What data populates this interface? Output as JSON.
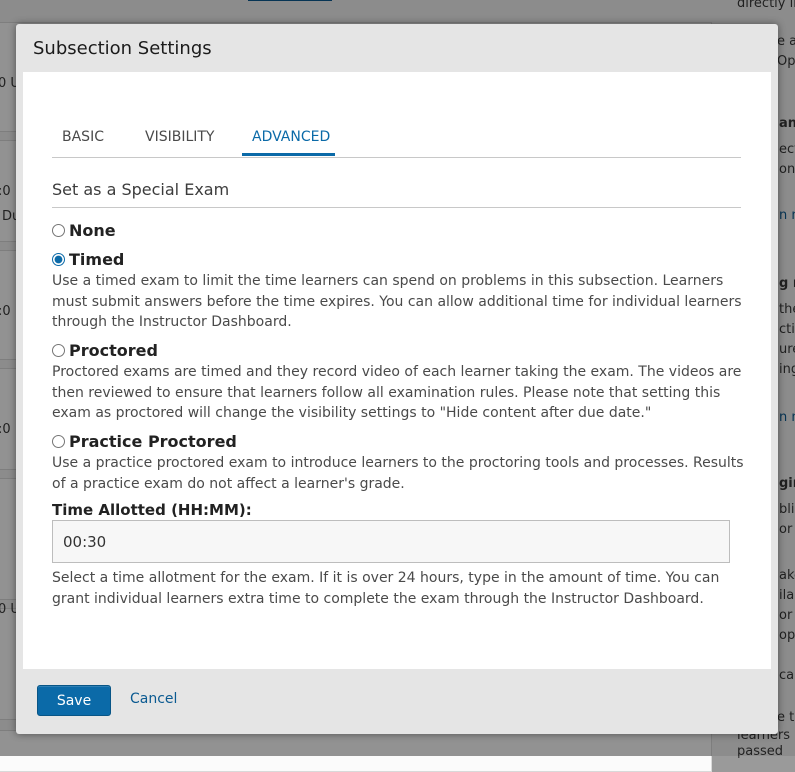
{
  "background": {
    "fragments": [
      "directly in",
      "e a",
      "Op",
      "ani",
      "ect",
      "ons",
      "n m",
      "g r",
      "the",
      "ctio",
      "ure",
      "ing p",
      "n m",
      "ging",
      "blis",
      "or a",
      "ake",
      "ilab",
      "or t",
      "opt",
      "calc",
      "e t",
      "learners",
      "passed",
      "0 U",
      ":0",
      "Du",
      ":0",
      ":0",
      "0 U"
    ]
  },
  "modal": {
    "title": "Subsection Settings",
    "tabs": [
      {
        "label": "BASIC",
        "active": false
      },
      {
        "label": "VISIBILITY",
        "active": false
      },
      {
        "label": "ADVANCED",
        "active": true
      }
    ],
    "section_heading": "Set as a Special Exam",
    "options": [
      {
        "label": "None",
        "selected": false,
        "description": ""
      },
      {
        "label": "Timed",
        "selected": true,
        "description": "Use a timed exam to limit the time learners can spend on problems in this subsection. Learners must submit answers before the time expires. You can allow additional time for individual learners through the Instructor Dashboard."
      },
      {
        "label": "Proctored",
        "selected": false,
        "description": "Proctored exams are timed and they record video of each learner taking the exam. The videos are then reviewed to ensure that learners follow all examination rules. Please note that setting this exam as proctored will change the visibility settings to \"Hide content after due date.\""
      },
      {
        "label": "Practice Proctored",
        "selected": false,
        "description": "Use a practice proctored exam to introduce learners to the proctoring tools and processes. Results of a practice exam do not affect a learner's grade."
      }
    ],
    "time_allotted": {
      "label": "Time Allotted (HH:MM):",
      "value": "00:30",
      "help": "Select a time allotment for the exam. If it is over 24 hours, type in the amount of time. You can grant individual learners extra time to complete the exam through the Instructor Dashboard."
    },
    "actions": {
      "save_label": "Save",
      "cancel_label": "Cancel"
    }
  },
  "colors": {
    "accent": "#0b6aa8",
    "overlay": "rgba(0,0,0,0.42)"
  }
}
